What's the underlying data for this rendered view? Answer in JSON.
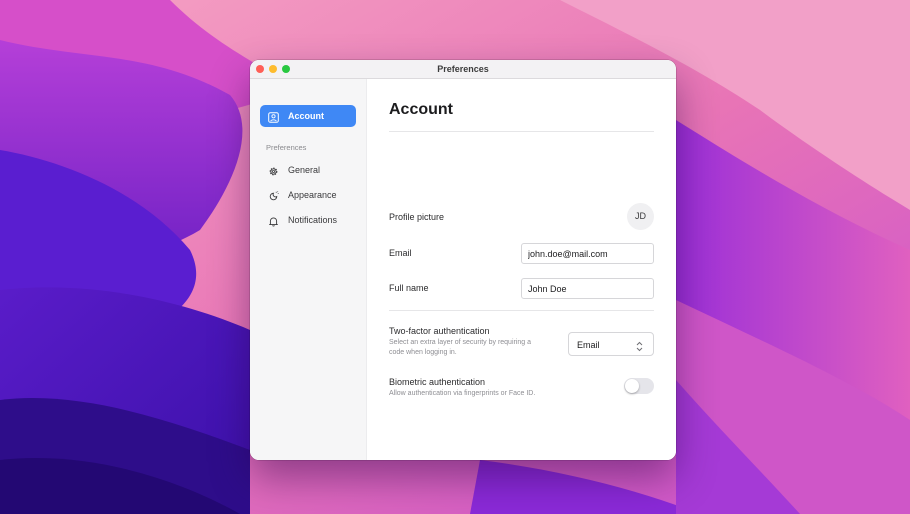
{
  "window": {
    "title": "Preferences"
  },
  "sidebar": {
    "active": {
      "label": "Account",
      "icon": "account-icon"
    },
    "section_label": "Preferences",
    "items": [
      {
        "label": "General",
        "icon": "gear-icon"
      },
      {
        "label": "Appearance",
        "icon": "appearance-icon"
      },
      {
        "label": "Notifications",
        "icon": "bell-icon"
      }
    ]
  },
  "main": {
    "heading": "Account",
    "profile": {
      "label": "Profile picture",
      "initials": "JD"
    },
    "email": {
      "label": "Email",
      "value": "john.doe@mail.com"
    },
    "full_name": {
      "label": "Full name",
      "value": "John Doe"
    },
    "two_factor": {
      "label": "Two-factor authentication",
      "description": "Select an extra layer of security by requiring a code when logging in.",
      "selected": "Email"
    },
    "biometric": {
      "label": "Biometric authentication",
      "description": "Allow authentication via fingerprints or Face ID.",
      "enabled": false
    }
  },
  "colors": {
    "accent": "#3f88f5",
    "wallpaper_pink": "#e66fb4",
    "wallpaper_purple": "#7a24c8"
  }
}
